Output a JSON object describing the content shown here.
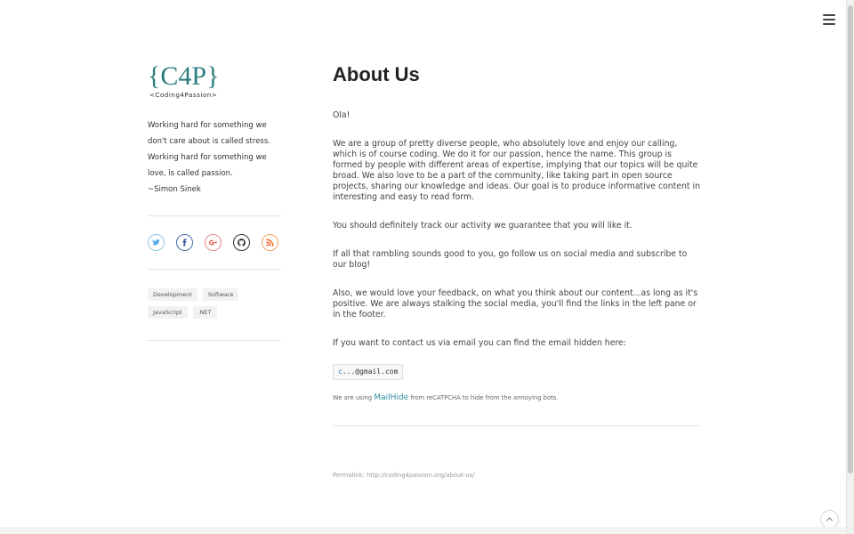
{
  "header": {
    "menu_icon": "hamburger-icon"
  },
  "brand": {
    "logo_main": "{C4P}",
    "logo_sub": "<Coding4Passion>",
    "color_teal": "#2d7f7f",
    "color_dark": "#2b2b2b"
  },
  "sidebar": {
    "quote": [
      "Working hard for something we don't care about is called stress.",
      "Working hard for something we love, is called passion.",
      "~Simon Sinek"
    ],
    "social": [
      {
        "name": "twitter",
        "icon": "twitter-icon"
      },
      {
        "name": "facebook",
        "icon": "facebook-icon"
      },
      {
        "name": "google-plus",
        "icon": "google-plus-icon"
      },
      {
        "name": "github",
        "icon": "github-icon"
      },
      {
        "name": "rss",
        "icon": "rss-icon"
      }
    ],
    "tags": [
      "Development",
      "Software",
      "JavaScript",
      ".NET"
    ]
  },
  "main": {
    "title": "About Us",
    "paragraphs": [
      "Ola!",
      "We are a group of pretty diverse people, who absolutely love and enjoy our calling, which is of course coding. We do it for our passion, hence the name. This group is formed by people with different areas of expertise, implying that our topics will be quite broad. We also love to be a part of the community, like taking part in open source projects, sharing our knowledge and ideas. Our goal is to produce informative content in interesting and easy to read form.",
      "You should definitely track our activity we guarantee that you will like it.",
      "If all that rambling sounds good to you, go follow us on social media and subscribe to our blog!",
      "Also, we would love your feedback, on what you think about our content...as long as it's positive. We are always stalking the social media, you'll find the links in the left pane or in the footer.",
      "If you want to contact us via email you can find the email hidden here:"
    ],
    "email_prefix": "c",
    "email_rest": "...@gmail.com",
    "mailhide_before": "We are using ",
    "mailhide_link": "MailHide",
    "mailhide_after": " from reCATPCHA to hide from the annoying bots.",
    "permalink": "Permalink: http://coding4passion.org/about-us/"
  },
  "footer": {
    "back_to_top_icon": "chevron-up-icon"
  }
}
